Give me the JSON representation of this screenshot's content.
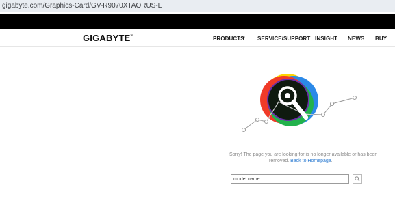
{
  "browser": {
    "url": "gigabyte.com/Graphics-Card/GV-R9070XTAORUS-E"
  },
  "header": {
    "logo": "GIGABYTE",
    "logo_tm": "™",
    "nav": {
      "products": "PRODUCTS",
      "products_caret": "▼",
      "service": "SERVICE/SUPPORT",
      "insight": "INSIGHT",
      "news": "NEWS",
      "buy": "BUY"
    }
  },
  "error": {
    "line1": "Sorry! The page you are looking for is no longer available or has been",
    "line2_prefix": "removed. ",
    "back_link": "Back to Homepage",
    "line2_suffix": "."
  },
  "search": {
    "value": "model name"
  },
  "colors": {
    "link": "#2a7ad1",
    "nav_bar": "#000000",
    "url_bar": "#e9edf2",
    "text_gray": "#8a8a8a"
  },
  "icons": {
    "illustration": "magnifier-on-chart-icon",
    "search_button": "search-icon"
  }
}
